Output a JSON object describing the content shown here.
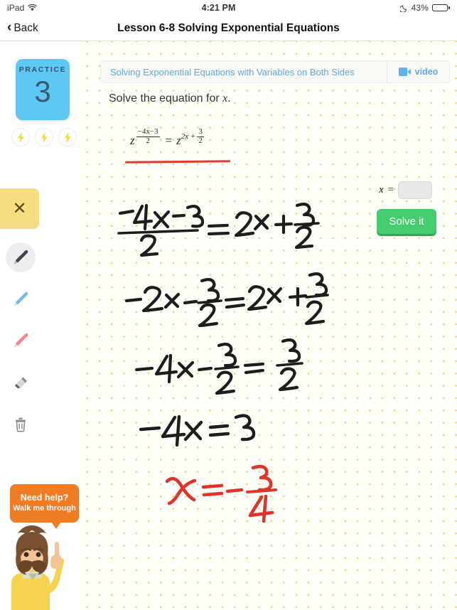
{
  "status_bar": {
    "device": "iPad",
    "wifi_icon": "wifi-icon",
    "time": "4:21 PM",
    "dnd_icon": "moon-icon",
    "battery_percent": "43%",
    "battery_level": 43
  },
  "nav_bar": {
    "back_label": "Back",
    "back_icon": "chevron-left-icon",
    "title": "Lesson 6-8 Solving Exponential Equations"
  },
  "practice": {
    "label": "PRACTICE",
    "number": "3",
    "streak_icons": [
      "bolt-icon",
      "bolt-icon",
      "bolt-icon"
    ]
  },
  "tools": {
    "close_icon": "close-icon",
    "items": [
      {
        "name": "pen-dark",
        "icon": "pencil-icon",
        "color": "#3d4450",
        "active": true
      },
      {
        "name": "pen-blue",
        "icon": "pencil-icon",
        "color": "#7cb8e8",
        "active": false
      },
      {
        "name": "pen-red",
        "icon": "pencil-icon",
        "color": "#f08a8a",
        "active": false
      },
      {
        "name": "eraser",
        "icon": "eraser-icon",
        "color": "#9a9a9a",
        "active": false
      },
      {
        "name": "trash",
        "icon": "trash-icon",
        "color": "#8d8d8d",
        "active": false
      }
    ]
  },
  "help": {
    "line1": "Need help?",
    "line2": "Walk me through",
    "bubble_color": "#f07c24",
    "mascot_icon": "tutor-mascot"
  },
  "lesson_bar": {
    "link_text": "Solving Exponential Equations with Variables on Both Sides",
    "video_label": "video",
    "video_icon": "video-camera-icon",
    "link_color": "#5fa9dd"
  },
  "problem": {
    "prompt_prefix": "Solve the equation for ",
    "prompt_var": "x",
    "prompt_suffix": ".",
    "equation": {
      "left_base": "z",
      "left_exp_num": "−4x−3",
      "left_exp_den": "2",
      "relation": "=",
      "right_base": "z",
      "right_exp_lead": "2x +",
      "right_exp_num": "3",
      "right_exp_den": "2"
    },
    "highlight_color": "#e03b2f"
  },
  "answer": {
    "variable": "x",
    "equals": "=",
    "input_value": "",
    "input_placeholder": "",
    "solve_label": "Solve it",
    "solve_color": "#45cc6e"
  },
  "handwriting": {
    "ink_color": "#1d1d1d",
    "answer_color": "#e0342a",
    "lines": [
      {
        "name": "work-line-1",
        "text": "(−4x − 3)/2 = 2x + 3/2"
      },
      {
        "name": "work-line-2",
        "text": "−2x − 3/2 = 2x + 3/2"
      },
      {
        "name": "work-line-3",
        "text": "−4x − 3/2 = 3/2"
      },
      {
        "name": "work-line-4",
        "text": "−4x = 3"
      },
      {
        "name": "work-line-5",
        "text": "x = − 3/4"
      }
    ]
  },
  "canvas": {
    "dot_color": "#f0cf78",
    "background": "#fffffa"
  }
}
